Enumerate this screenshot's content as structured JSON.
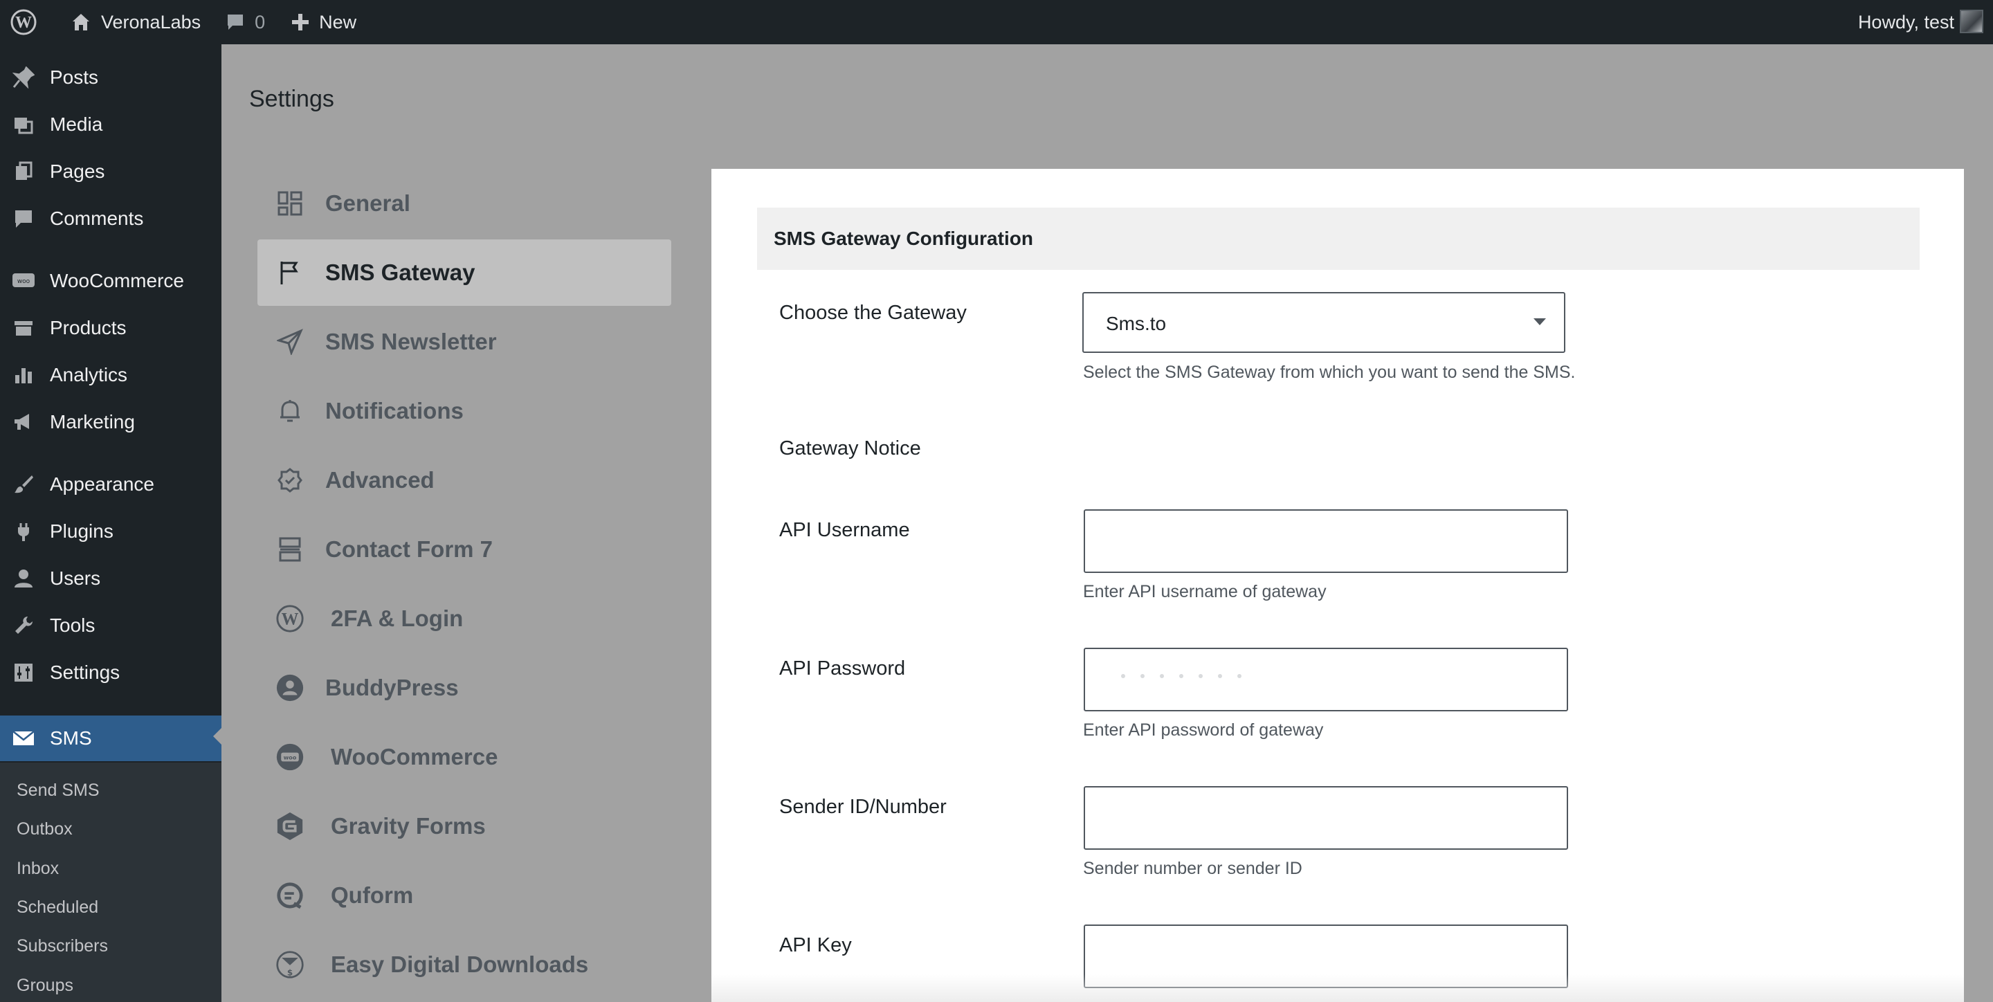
{
  "admin_bar": {
    "site_name": "VeronaLabs",
    "comments_count": "0",
    "new_label": "New",
    "howdy": "Howdy, test"
  },
  "admin_menu": {
    "items": [
      {
        "label": "Posts",
        "icon": "pin-icon"
      },
      {
        "label": "Media",
        "icon": "media-icon"
      },
      {
        "label": "Pages",
        "icon": "pages-icon"
      },
      {
        "label": "Comments",
        "icon": "comment-icon"
      },
      {
        "label": "WooCommerce",
        "icon": "woo-icon"
      },
      {
        "label": "Products",
        "icon": "archive-icon"
      },
      {
        "label": "Analytics",
        "icon": "bar-chart-icon"
      },
      {
        "label": "Marketing",
        "icon": "megaphone-icon"
      },
      {
        "label": "Appearance",
        "icon": "brush-icon"
      },
      {
        "label": "Plugins",
        "icon": "plug-icon"
      },
      {
        "label": "Users",
        "icon": "user-icon"
      },
      {
        "label": "Tools",
        "icon": "wrench-icon"
      },
      {
        "label": "Settings",
        "icon": "sliders-icon"
      },
      {
        "label": "SMS",
        "icon": "envelope-icon",
        "current": true
      }
    ],
    "submenu": [
      "Send SMS",
      "Outbox",
      "Inbox",
      "Scheduled",
      "Subscribers",
      "Groups"
    ]
  },
  "page": {
    "title": "Settings"
  },
  "tabs": [
    {
      "label": "General",
      "icon": "grid-icon"
    },
    {
      "label": "SMS Gateway",
      "icon": "flag-icon",
      "active": true
    },
    {
      "label": "SMS Newsletter",
      "icon": "paper-plane-icon"
    },
    {
      "label": "Notifications",
      "icon": "bell-icon"
    },
    {
      "label": "Advanced",
      "icon": "badge-check-icon"
    },
    {
      "label": "Contact Form 7",
      "icon": "form-layout-icon"
    },
    {
      "label": "2FA & Login",
      "icon": "wordpress-icon"
    },
    {
      "label": "BuddyPress",
      "icon": "buddypress-icon"
    },
    {
      "label": "WooCommerce",
      "icon": "woo-icon"
    },
    {
      "label": "Gravity Forms",
      "icon": "gravity-forms-icon"
    },
    {
      "label": "Quform",
      "icon": "quform-icon"
    },
    {
      "label": "Easy Digital Downloads",
      "icon": "edd-icon"
    }
  ],
  "panel": {
    "header": "SMS Gateway Configuration",
    "gateway": {
      "label": "Choose the Gateway",
      "selected": "Sms.to",
      "help": "Select the SMS Gateway from which you want to send the SMS."
    },
    "gateway_notice": {
      "label": "Gateway Notice"
    },
    "api_username": {
      "label": "API Username",
      "value": "",
      "help": "Enter API username of gateway"
    },
    "api_password": {
      "label": "API Password",
      "value": "",
      "help": "Enter API password of gateway"
    },
    "sender_id": {
      "label": "Sender ID/Number",
      "value": "",
      "help": "Sender number or sender ID"
    },
    "api_key": {
      "label": "API Key",
      "value": ""
    }
  },
  "colors": {
    "admin_bar_bg": "#1d2327",
    "menu_current": "#2e5d8c",
    "overlay_bg": "#a2a2a2",
    "panel_bg": "#ffffff"
  }
}
